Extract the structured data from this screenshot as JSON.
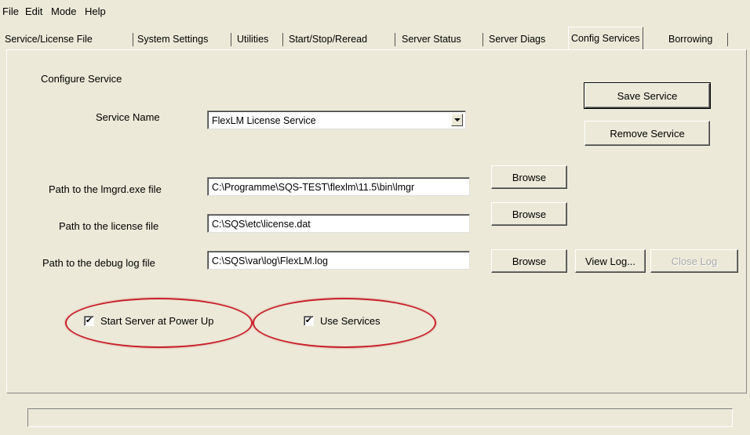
{
  "menu": [
    "File",
    "Edit",
    "Mode",
    "Help"
  ],
  "tabs": [
    "Service/License File",
    "System Settings",
    "Utilities",
    "Start/Stop/Reread",
    "Server Status",
    "Server Diags",
    "Config Services",
    "Borrowing"
  ],
  "active_tab": "Config Services",
  "config": {
    "group_label": "Configure Service",
    "service_name_label": "Service Name",
    "service_name_value": "FlexLM License Service",
    "lmgrd_label": "Path to the lmgrd.exe file",
    "lmgrd_value": "C:\\Programme\\SQS-TEST\\flexlm\\11.5\\bin\\lmgr",
    "license_label": "Path to the license file",
    "license_value": "C:\\SQS\\etc\\license.dat",
    "debug_label": "Path to the debug log file",
    "debug_value": "C:\\SQS\\var\\log\\FlexLM.log",
    "browse_label": "Browse",
    "save_label": "Save Service",
    "remove_label": "Remove Service",
    "view_log_label": "View Log...",
    "close_log_label": "Close Log",
    "start_server_label": "Start Server at Power Up",
    "start_server_checked": true,
    "use_services_label": "Use Services",
    "use_services_checked": true
  },
  "status_text": "",
  "colors": {
    "window_bg": "#ece9d8",
    "highlight_ellipse": "#c8202a"
  }
}
